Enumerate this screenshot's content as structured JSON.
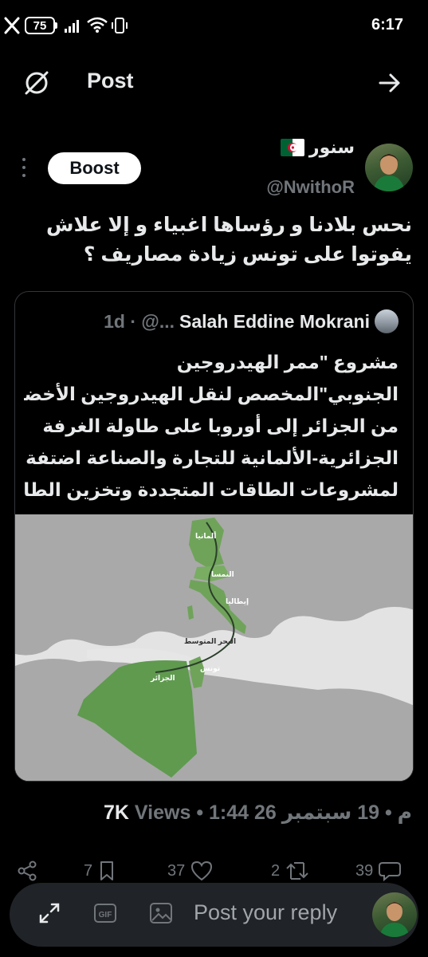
{
  "status_bar": {
    "battery": "75",
    "time": "6:17"
  },
  "header": {
    "title": "Post",
    "left_icon": "no-signal-circle-icon",
    "right_icon": "arrow-right-icon"
  },
  "tweet": {
    "boost_label": "Boost",
    "display_name": "سنور",
    "handle": "@NwithoR",
    "text_lines": [
      "نحس بلادنا و رؤساها اغبياء و إلا علاش",
      "يفوتوا على تونس زيادة مصاريف ؟"
    ]
  },
  "quote": {
    "meta": "1d · @...",
    "name": "Salah Eddine Mokrani",
    "text_lines": [
      "مشروع \"ممر الهيدروجين",
      "الجنوبي\"المخصص لنقل الهيدروجين الأخضر",
      "من الجزائر إلى أوروبا على طاولة الغرفة",
      "الجزائرية-الألمانية للتجارة والصناعة اضتفة",
      "لمشروعات الطاقات المتجددة وتخزين الطا..."
    ],
    "map_labels": {
      "germany": "ألمانيا",
      "austria": "النمسا",
      "italy": "إيطاليا",
      "med": "البحر المتوسط",
      "tunisia": "تونس",
      "algeria": "الجزائر"
    }
  },
  "post_meta": {
    "time_date": "1:44 م • 19 سبتمبر 26",
    "views_count": "7K",
    "views_label": "Views"
  },
  "actions": {
    "replies": "39",
    "reposts": "2",
    "likes": "37",
    "bookmarks": "7"
  },
  "reply_bar": {
    "placeholder": "Post your reply"
  }
}
